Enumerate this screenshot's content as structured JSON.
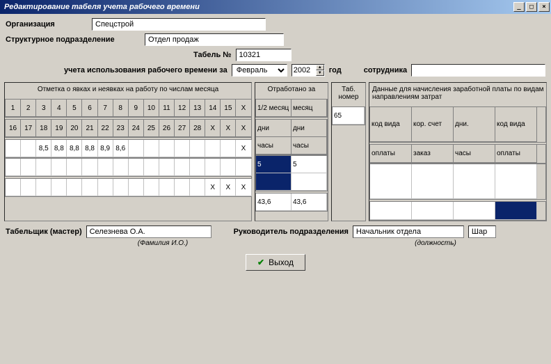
{
  "window": {
    "title": "Редактирование табеля учета рабочего времени",
    "min": "_",
    "max": "□",
    "close": "×"
  },
  "form": {
    "org_label": "Организация",
    "org_value": "Спецстрой",
    "dept_label": "Структурное подразделение",
    "dept_value": "Отдел продаж",
    "tabel_label": "Табель №",
    "tabel_value": "10321",
    "period_label": "учета использования рабочего времени за",
    "month": "Февраль",
    "year": "2002",
    "year_label": "год",
    "employee_label": "сотрудника",
    "employee_value": ""
  },
  "panels": {
    "attendance": {
      "title": "Отметка о явках и неявках на работу по числам месяца",
      "row1": [
        "1",
        "2",
        "3",
        "4",
        "5",
        "6",
        "7",
        "8",
        "9",
        "10",
        "11",
        "12",
        "13",
        "14",
        "15",
        "X"
      ],
      "row2": [
        "16",
        "17",
        "18",
        "19",
        "20",
        "21",
        "22",
        "23",
        "24",
        "25",
        "26",
        "27",
        "28",
        "X",
        "X",
        "X"
      ],
      "data1": [
        "",
        "",
        "8,5",
        "8,8",
        "8,8",
        "8,8",
        "8,9",
        "8,6",
        "",
        "",
        "",
        "",
        "",
        "",
        "",
        "X"
      ],
      "data2": [
        "",
        "",
        "",
        "",
        "",
        "",
        "",
        "",
        "",
        "",
        "",
        "",
        "",
        "X",
        "X",
        "X"
      ]
    },
    "worked": {
      "title": "Отработано за",
      "h1a": "1/2 месяц",
      "h1b": "месяц",
      "h2a": "дни",
      "h2b": "дни",
      "h3a": "часы",
      "h3b": "часы",
      "v1a": "5",
      "v1b": "5",
      "v2a": "",
      "v2b": "",
      "v3a": "43,6",
      "v3b": "43,6"
    },
    "tabnum": {
      "title": "Таб. номер",
      "value": "65"
    },
    "payroll": {
      "title": "Данные для начисления заработной платы по видам направлениям затрат",
      "h1": "код вида",
      "h2": "кор. счет",
      "h3": "дни.",
      "h4": "код вида",
      "h5": "оплаты",
      "h6": "заказ",
      "h7": "часы",
      "h8": "оплаты"
    }
  },
  "footer": {
    "tab_master_label": "Табельщик (мастер)",
    "tab_master_value": "Селезнева О.А.",
    "tab_master_hint": "(Фамилия И.О.)",
    "head_label": "Руководитель подразделения",
    "head_value": "Начальник отдела",
    "head_hint": "(должность)",
    "extra": "Шар"
  },
  "exit_label": "Выход"
}
